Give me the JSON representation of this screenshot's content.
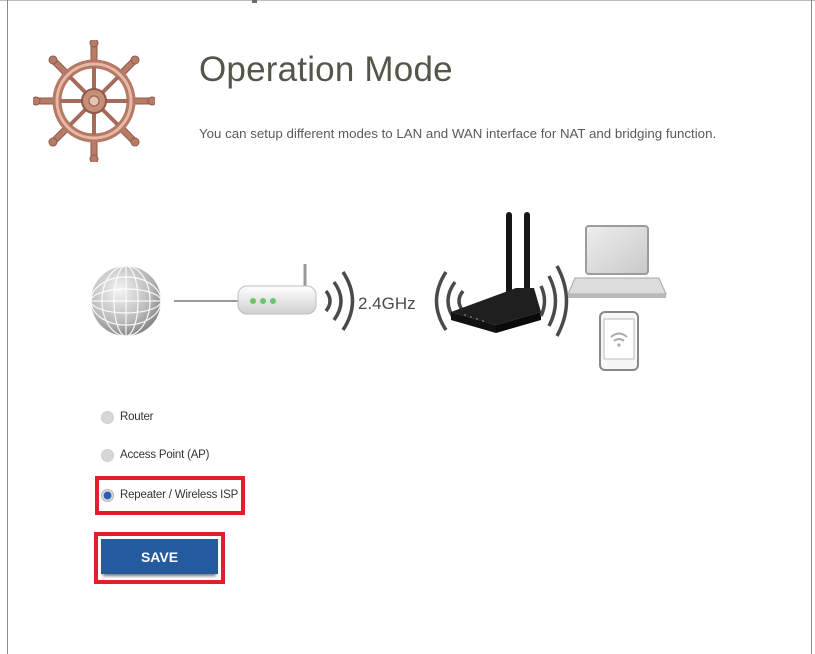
{
  "page": {
    "title": "Operation Mode",
    "subtitle": "You can setup different modes to LAN and WAN interface for NAT and bridging function."
  },
  "diagram": {
    "band_label": "2.4GHz"
  },
  "modes": {
    "selected": "repeater",
    "options": [
      {
        "id": "router",
        "label": "Router",
        "checked": false
      },
      {
        "id": "ap",
        "label": "Access Point (AP)",
        "checked": false
      },
      {
        "id": "repeater",
        "label": "Repeater / Wireless ISP",
        "checked": true
      }
    ]
  },
  "actions": {
    "save_label": "SAVE"
  },
  "colors": {
    "accent": "#245b9f",
    "highlight": "#e01f2d",
    "radio_selected": "#2d5fb0",
    "title": "#55554a"
  },
  "icons": {
    "logo": "ship-wheel-icon",
    "internet": "globe-icon",
    "modem": "modem-icon",
    "router": "router-icon",
    "laptop": "laptop-icon",
    "tablet": "tablet-icon"
  }
}
